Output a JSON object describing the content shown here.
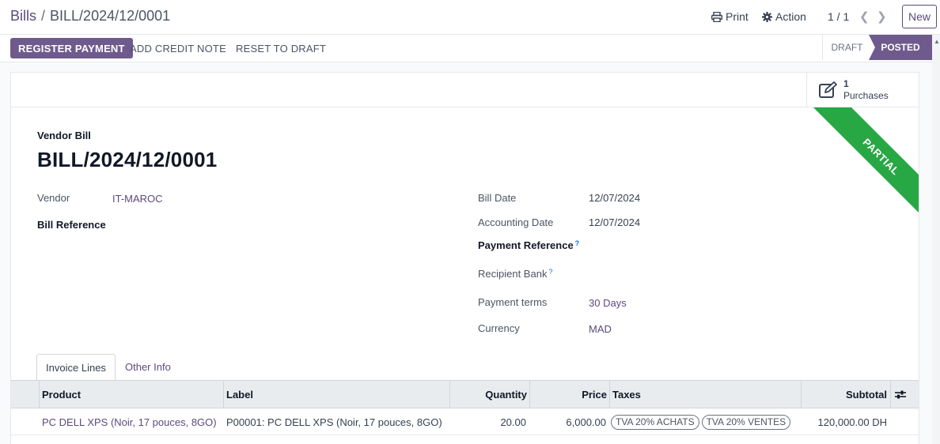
{
  "breadcrumb": {
    "parent": "Bills",
    "current": "BILL/2024/12/0001"
  },
  "controls": {
    "print_label": "Print",
    "action_label": "Action",
    "pager": "1 / 1",
    "new_label": "New"
  },
  "statusbar": {
    "register_payment": "REGISTER PAYMENT",
    "add_credit_note": "ADD CREDIT NOTE",
    "reset_to_draft": "RESET TO DRAFT",
    "stages": [
      "DRAFT",
      "POSTED"
    ],
    "active_stage": "POSTED"
  },
  "smart_button": {
    "count": "1",
    "label": "Purchases"
  },
  "ribbon": "PARTIAL",
  "document": {
    "type_label": "Vendor Bill",
    "number": "BILL/2024/12/0001"
  },
  "fields_left": {
    "vendor_label": "Vendor",
    "vendor_value": "IT-MAROC",
    "bill_reference_label": "Bill Reference"
  },
  "fields_right": {
    "bill_date_label": "Bill Date",
    "bill_date_value": "12/07/2024",
    "accounting_date_label": "Accounting Date",
    "accounting_date_value": "12/07/2024",
    "payment_reference_label": "Payment Reference",
    "recipient_bank_label": "Recipient Bank",
    "payment_terms_label": "Payment terms",
    "payment_terms_value": "30 Days",
    "currency_label": "Currency",
    "currency_value": "MAD",
    "hint_mark": "?"
  },
  "tabs": [
    "Invoice Lines",
    "Other Info"
  ],
  "table": {
    "columns": [
      "Product",
      "Label",
      "Quantity",
      "Price",
      "Taxes",
      "Subtotal"
    ],
    "rows": [
      {
        "product": "PC DELL XPS (Noir, 17 pouces, 8GO)",
        "label": "P00001: PC DELL XPS (Noir, 17 pouces, 8GO)",
        "quantity": "20.00",
        "price": "6,000.00",
        "taxes": [
          "TVA 20% ACHATS",
          "TVA 20% VENTES"
        ],
        "subtotal": "120,000.00 DH"
      }
    ]
  },
  "colors": {
    "brand": "#6f5a8e",
    "link": "#5b4a7e",
    "ribbon": "#28a745"
  }
}
